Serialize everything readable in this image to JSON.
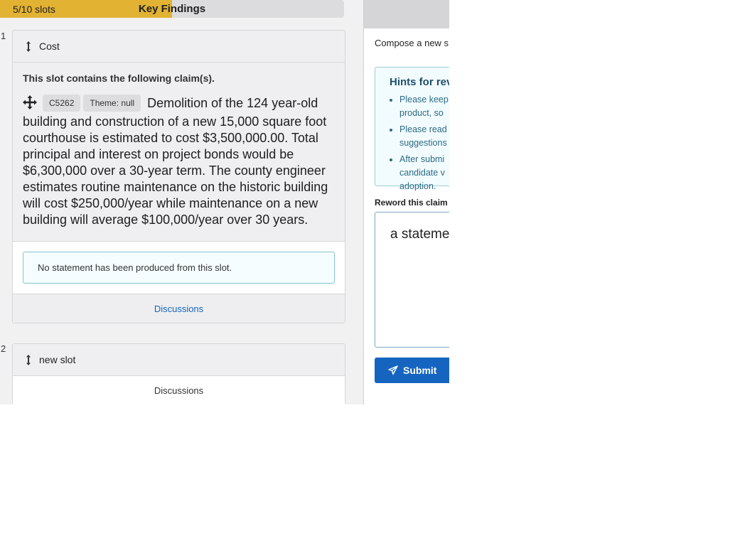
{
  "progress": {
    "slots_label": "5/10 slots",
    "title": "Key Findings",
    "fill_fraction": 0.5
  },
  "slots": [
    {
      "number": "1",
      "title": "Cost",
      "claims_intro": "This slot contains the following claim(s).",
      "claim": {
        "id": "C5262",
        "theme": "Theme: null",
        "text": "Demolition of the 124 year-old building and construction of a new 15,000 square foot courthouse is estimated to cost $3,500,000.00. Total principal and interest on project bonds would be $6,300,000 over a 30-year term. The county engineer estimates routine maintenance on the historic building will cost $250,000/year while maintenance on a new building will average $100,000/year over 30 years."
      },
      "statement_notice": "No statement has been produced from this slot.",
      "discussions_label": "Discussions"
    },
    {
      "number": "2",
      "title": "new slot",
      "discussions_label": "Discussions"
    }
  ],
  "compose": {
    "label": "Compose a new s",
    "hints_title": "Hints for rev",
    "hints": [
      [
        "Please keep",
        "product, so"
      ],
      [
        "Please read",
        "suggestions"
      ],
      [
        "After submi",
        "candidate v",
        "adoption."
      ]
    ],
    "reword_label": "Reword this claim",
    "textarea_value": "a stateme",
    "submit_label": "Submit"
  },
  "colors": {
    "progress_fill": "#e2b233",
    "accent_blue": "#1565c0",
    "hint_border": "#9ecfd8"
  }
}
